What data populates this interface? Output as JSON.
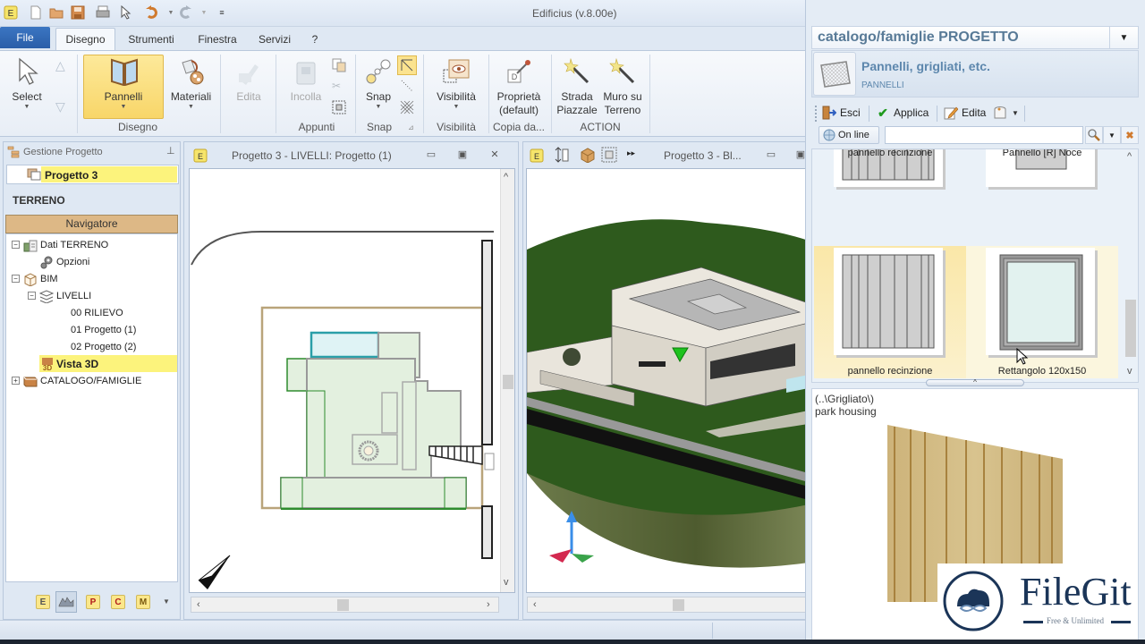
{
  "app": {
    "title": "Edificius (v.8.00e)"
  },
  "quick_access": {
    "icons": [
      "app-logo-icon",
      "new-file-icon",
      "open-folder-icon",
      "save-icon",
      "print-icon",
      "pointer-icon",
      "undo-icon",
      "redo-icon",
      "customize-icon"
    ]
  },
  "tabs": {
    "file": "File",
    "items": [
      "Disegno",
      "Strumenti",
      "Finestra",
      "Servizi",
      "?"
    ],
    "active": "Disegno"
  },
  "ribbon": {
    "select": "Select",
    "pannelli": "Pannelli",
    "materiali": "Materiali",
    "edita": "Edita",
    "incolla": "Incolla",
    "snap": "Snap",
    "visibilita": "Visibilità",
    "proprieta_1": "Proprietà",
    "proprieta_2": "(default)",
    "strada_1": "Strada",
    "strada_2": "Piazzale",
    "muro_1": "Muro su",
    "muro_2": "Terreno",
    "groups": {
      "disegno": "Disegno",
      "appunti": "Appunti",
      "snap": "Snap",
      "visibilita": "Visibilità",
      "copia": "Copia da...",
      "action": "ACTION"
    }
  },
  "left_panel": {
    "header": "Gestione Progetto",
    "project": "Progetto 3",
    "section": "TERRENO",
    "navigator": "Navigatore",
    "tree": [
      {
        "label": "Dati TERRENO",
        "level": 0,
        "expander": "−",
        "icon": "terrain-data-icon"
      },
      {
        "label": "Opzioni",
        "level": 1,
        "expander": "",
        "icon": "gear-icon"
      },
      {
        "label": "BIM",
        "level": 0,
        "expander": "−",
        "icon": "bim-icon"
      },
      {
        "label": "LIVELLI",
        "level": 1,
        "expander": "−",
        "icon": "layers-icon"
      },
      {
        "label": "00 RILIEVO",
        "level": 2,
        "expander": "",
        "icon": ""
      },
      {
        "label": "01 Progetto (1)",
        "level": 2,
        "expander": "",
        "icon": ""
      },
      {
        "label": "02 Progetto (2)",
        "level": 2,
        "expander": "",
        "icon": ""
      },
      {
        "label": "Vista 3D",
        "level": 1,
        "expander": "",
        "icon": "3d-view-icon",
        "selected": true
      },
      {
        "label": "CATALOGO/FAMIGLIE",
        "level": 0,
        "expander": "+",
        "icon": "catalog-book-icon"
      }
    ],
    "bottom_buttons": [
      "E",
      "terrain",
      "P",
      "C",
      "M"
    ]
  },
  "doc_plan": {
    "title": "Progetto 3 -  LIVELLI: Progetto (1)"
  },
  "doc_3d": {
    "title": "Progetto 3 -  Bl..."
  },
  "catalog": {
    "header": "catalogo/famiglie PROGETTO",
    "category_name": "Pannelli, grigliati, etc.",
    "category_sub": "PANNELLI",
    "toolbar": {
      "esci": "Esci",
      "applica": "Applica",
      "edita": "Edita"
    },
    "online": "On line",
    "search_value": "",
    "items": [
      {
        "label": "pannello recinzione",
        "type": "fence"
      },
      {
        "label": "Pannello [R] Noce",
        "type": "plain"
      },
      {
        "label": "pannello recinzione",
        "type": "fence",
        "selected": true
      },
      {
        "label": "Rettangolo 120x150",
        "type": "frame",
        "hover": true
      }
    ],
    "preview_path": "(..\\Grigliato\\)",
    "preview_name": "park housing"
  },
  "watermark": {
    "brand": "FileGit",
    "tagline": "Free & Unlimited"
  },
  "colors": {
    "accent_blue": "#2a5ea8",
    "highlight_yellow": "#fcf37c",
    "navigator_tan": "#ddb886",
    "catalog_title": "#587a97",
    "grass": "#2f5a1c"
  }
}
